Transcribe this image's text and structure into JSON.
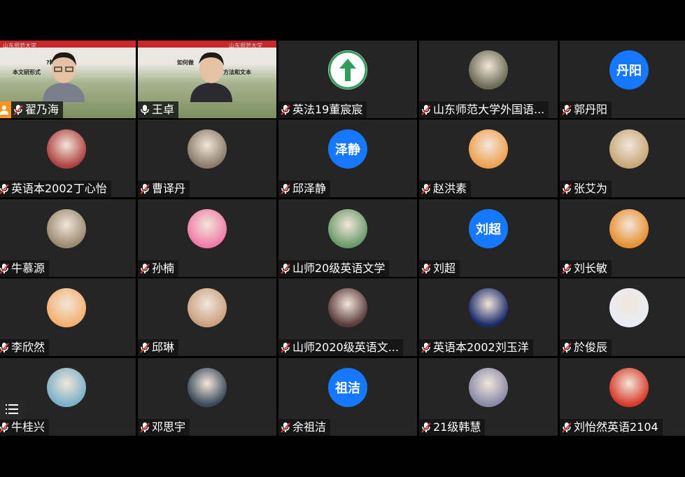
{
  "participants": [
    {
      "name": "翟乃海",
      "kind": "video",
      "host": true
    },
    {
      "name": "王卓",
      "kind": "video",
      "active": true
    },
    {
      "name": "英法19董宸宸",
      "kind": "icon",
      "avatar": "green-arrow-icon"
    },
    {
      "name": "山东师范大学外国语...",
      "kind": "photo",
      "avatar": "woman-photo-avatar",
      "color": "#6a6a55"
    },
    {
      "name": "郭丹阳",
      "kind": "text",
      "initials": "丹阳"
    },
    {
      "name": "英语本2002丁心怡",
      "kind": "photo",
      "avatar": "puppy-avatar",
      "color": "#b04040"
    },
    {
      "name": "曹译丹",
      "kind": "photo",
      "avatar": "bear-avatar",
      "color": "#8a7a6a"
    },
    {
      "name": "邱泽静",
      "kind": "text",
      "initials": "泽静"
    },
    {
      "name": "赵洪素",
      "kind": "photo",
      "avatar": "cartoon-girl-avatar",
      "color": "#f0a050"
    },
    {
      "name": "张艾为",
      "kind": "photo",
      "avatar": "painting-avatar",
      "color": "#c8a878"
    },
    {
      "name": "牛慕源",
      "kind": "photo",
      "avatar": "old-man-avatar",
      "color": "#9a8a70"
    },
    {
      "name": "孙楠",
      "kind": "photo",
      "avatar": "pink-bear-avatar",
      "color": "#f07aa8"
    },
    {
      "name": "山师20级英语文学",
      "kind": "photo",
      "avatar": "cartoon-boy-avatar",
      "color": "#6a9a6a"
    },
    {
      "name": "刘超",
      "kind": "text",
      "initials": "刘超"
    },
    {
      "name": "刘长敏",
      "kind": "photo",
      "avatar": "tiger-avatar",
      "color": "#e89030"
    },
    {
      "name": "李欣然",
      "kind": "photo",
      "avatar": "bunny-avatar",
      "color": "#f5b070"
    },
    {
      "name": "邱琳",
      "kind": "photo",
      "avatar": "baby-avatar",
      "color": "#caa080"
    },
    {
      "name": "山师2020级英语文...",
      "kind": "photo",
      "avatar": "singer-avatar",
      "color": "#5a3a3a"
    },
    {
      "name": "英语本2002刘玉洋",
      "kind": "photo",
      "avatar": "night-sky-avatar",
      "color": "#1a2a6a"
    },
    {
      "name": "於俊辰",
      "kind": "photo",
      "avatar": "anime-boy-avatar",
      "color": "#e8ecf4"
    },
    {
      "name": "牛桂兴",
      "kind": "photo",
      "avatar": "wave-avatar",
      "color": "#7ab0c8"
    },
    {
      "name": "邓思宇",
      "kind": "photo",
      "avatar": "anime-avatar",
      "color": "#3a4a5a"
    },
    {
      "name": "余祖洁",
      "kind": "text",
      "initials": "祖洁"
    },
    {
      "name": "21级韩慧",
      "kind": "photo",
      "avatar": "sunset-girl-avatar",
      "color": "#8a8aa8"
    },
    {
      "name": "刘怡然英语2104",
      "kind": "photo",
      "avatar": "flag-girl-avatar",
      "color": "#d83a2a"
    }
  ],
  "video_slides": {
    "left": {
      "line1": "?料揣",
      "line2": "本文研形式",
      "logo": "山东师范大学"
    },
    "right": {
      "line1": "如何做",
      "line2": "方法和文本",
      "logo": "山东师范大学"
    }
  },
  "colors": {
    "tile_bg": "#252525",
    "avatar_blue": "#1677ff",
    "active_border": "#27c24c",
    "host_orange": "#f7941d"
  }
}
